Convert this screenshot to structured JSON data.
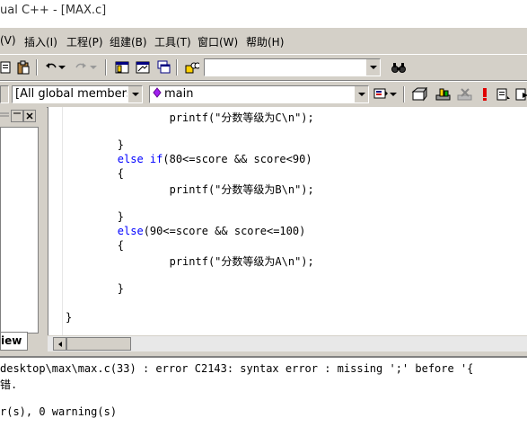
{
  "window": {
    "title": "ual C++ - [MAX.c]"
  },
  "menu": [
    {
      "label": "(V)"
    },
    {
      "label": "插入(I)"
    },
    {
      "label": "工程(P)"
    },
    {
      "label": "组建(B)"
    },
    {
      "label": "工具(T)"
    },
    {
      "label": "窗口(W)"
    },
    {
      "label": "帮助(H)"
    }
  ],
  "toolbar1": {
    "find_combo_value": "",
    "icons": [
      "new-file-icon",
      "clipboard-icon",
      "undo-icon",
      "redo-icon",
      "workspace-icon",
      "output-window-icon",
      "window-list-icon",
      "find-in-files-icon",
      "find-icon"
    ]
  },
  "toolbar2": {
    "scope_combo": "[All global members",
    "function_combo": "main",
    "icons": [
      "wizard-action-icon",
      "compile-icon",
      "build-icon",
      "stop-build-icon",
      "execute-icon",
      "insert-breakpoint-icon",
      "go-icon"
    ]
  },
  "workspace": {
    "tab_label": "iew"
  },
  "editor": {
    "lines": [
      [
        {
          "t": "                printf(\"分数等级为C\\n\");",
          "c": ""
        }
      ],
      [
        {
          "t": "",
          "c": ""
        }
      ],
      [
        {
          "t": "        }",
          "c": ""
        }
      ],
      [
        {
          "t": "        ",
          "c": ""
        },
        {
          "t": "else if",
          "c": "kw"
        },
        {
          "t": "(80<=score && score<90)",
          "c": ""
        }
      ],
      [
        {
          "t": "        {",
          "c": ""
        }
      ],
      [
        {
          "t": "                printf(\"分数等级为B\\n\");",
          "c": ""
        }
      ],
      [
        {
          "t": "",
          "c": ""
        }
      ],
      [
        {
          "t": "        }",
          "c": ""
        }
      ],
      [
        {
          "t": "        ",
          "c": ""
        },
        {
          "t": "else",
          "c": "kw"
        },
        {
          "t": "(90<=score && score<=100)",
          "c": ""
        }
      ],
      [
        {
          "t": "        {",
          "c": ""
        }
      ],
      [
        {
          "t": "                printf(\"分数等级为A\\n\");",
          "c": ""
        }
      ],
      [
        {
          "t": "",
          "c": ""
        }
      ],
      [
        {
          "t": "        }",
          "c": ""
        }
      ],
      [
        {
          "t": "",
          "c": ""
        }
      ],
      [
        {
          "t": "}",
          "c": ""
        }
      ]
    ]
  },
  "output": {
    "lines": [
      "desktop\\max\\max.c(33) : error C2143: syntax error : missing ';' before '{",
      "错.",
      "",
      "r(s), 0 warning(s)"
    ]
  },
  "colors": {
    "keyword": "#0000ff",
    "chrome": "#d4d0c8"
  }
}
